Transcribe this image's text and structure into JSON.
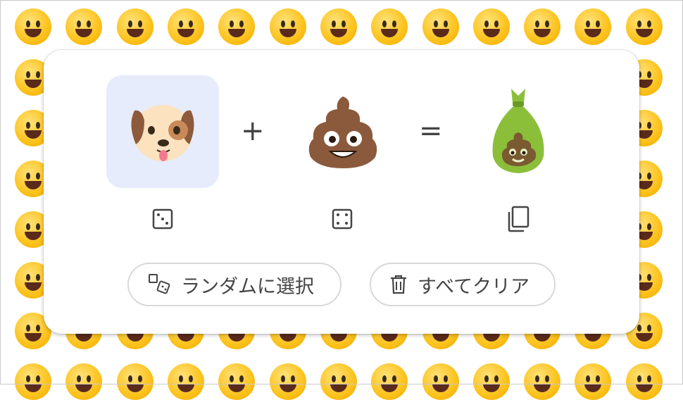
{
  "background_grid": {
    "rows": [
      [
        "😀",
        "😃",
        "😄",
        "😁",
        "😆",
        "😅",
        "😂",
        "🤣",
        "😭",
        "😉",
        "😗",
        "😙",
        "😚"
      ],
      [
        "🥰",
        "",
        "",
        "",
        "",
        "",
        "",
        "",
        "",
        "",
        "",
        "",
        "😏"
      ],
      [
        "😪",
        "",
        "",
        "",
        "",
        "",
        "",
        "",
        "",
        "",
        "",
        "",
        "😐"
      ],
      [
        "😶‍🌫️",
        "",
        "",
        "",
        "",
        "",
        "",
        "",
        "",
        "",
        "",
        "",
        "🤨"
      ],
      [
        "😒",
        "",
        "",
        "",
        "",
        "",
        "",
        "",
        "",
        "",
        "",
        "",
        "🙁"
      ],
      [
        "🫤",
        "",
        "",
        "",
        "",
        "",
        "",
        "",
        "",
        "",
        "",
        "",
        "😣"
      ],
      [
        "😫",
        "😦",
        "🥶",
        "😥",
        "🤢",
        "🤮",
        "🤧",
        "🤒",
        "😕",
        "😷",
        "🫤",
        "🙂",
        "🤠"
      ],
      [
        "🤓",
        "😎",
        "🥸",
        "🤡",
        "😈",
        "👿",
        "👻",
        "🎃",
        "💩",
        "🤖",
        "👽",
        "👾",
        "🌙"
      ]
    ]
  },
  "mixer": {
    "left_emoji": "🐶",
    "right_emoji": "💩",
    "result_emoji": "💩",
    "plus_symbol": "+",
    "equals_symbol": "="
  },
  "actions": {
    "random_label": "ランダムに選択",
    "clear_label": "すべてクリア"
  },
  "colors": {
    "selected_slot_bg": "#e6ecfb",
    "pill_border": "#d8d8d8",
    "text": "#444444"
  },
  "icons": {
    "left_random": "dice-icon",
    "right_random": "dice-icon",
    "copy": "copy-icon",
    "random_button": "shapes-icon",
    "clear_button": "trash-icon"
  }
}
